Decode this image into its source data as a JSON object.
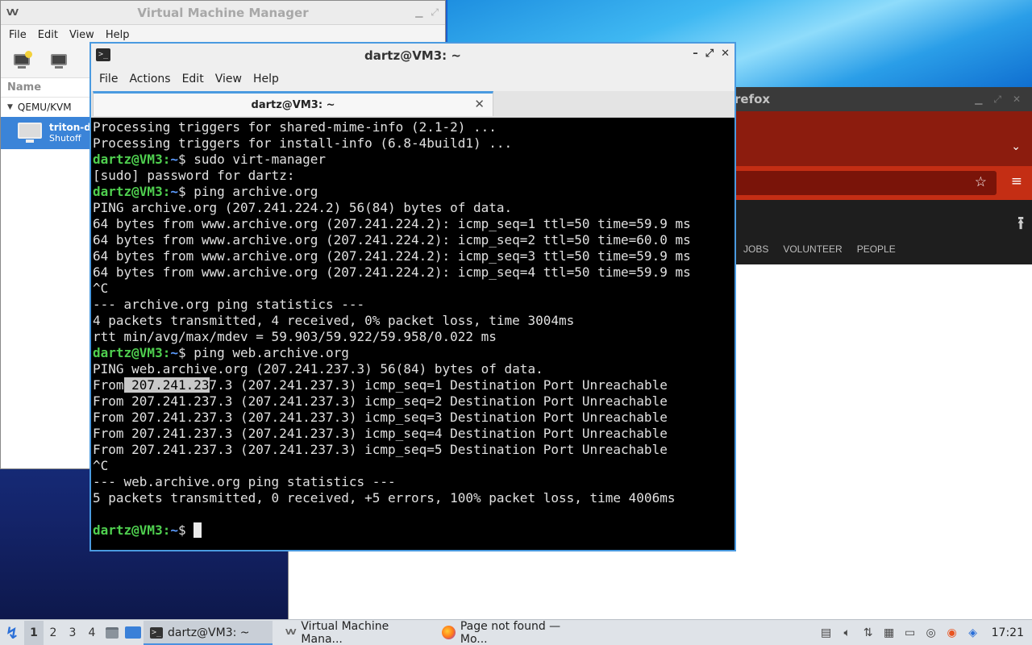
{
  "vmm": {
    "title": "Virtual Machine Manager",
    "menu": [
      "File",
      "Edit",
      "View",
      "Help"
    ],
    "column_header": "Name",
    "group": "QEMU/KVM",
    "vm": {
      "name": "triton-d",
      "status": "Shutoff"
    }
  },
  "firefox": {
    "title_fragment": "refox",
    "nav_links": [
      "JOBS",
      "VOLUNTEER",
      "PEOPLE"
    ]
  },
  "terminal": {
    "title": "dartz@VM3: ~",
    "menu": [
      "File",
      "Actions",
      "Edit",
      "View",
      "Help"
    ],
    "tab_label": "dartz@VM3: ~",
    "prompt_user": "dartz@VM3",
    "prompt_path": "~",
    "lines": [
      {
        "type": "out",
        "text": "Processing triggers for shared-mime-info (2.1-2) ..."
      },
      {
        "type": "out",
        "text": "Processing triggers for install-info (6.8-4build1) ..."
      },
      {
        "type": "cmd",
        "text": "sudo virt-manager"
      },
      {
        "type": "out",
        "text": "[sudo] password for dartz:"
      },
      {
        "type": "cmd",
        "text": "ping archive.org"
      },
      {
        "type": "out",
        "text": "PING archive.org (207.241.224.2) 56(84) bytes of data."
      },
      {
        "type": "out",
        "text": "64 bytes from www.archive.org (207.241.224.2): icmp_seq=1 ttl=50 time=59.9 ms"
      },
      {
        "type": "out",
        "text": "64 bytes from www.archive.org (207.241.224.2): icmp_seq=2 ttl=50 time=60.0 ms"
      },
      {
        "type": "out",
        "text": "64 bytes from www.archive.org (207.241.224.2): icmp_seq=3 ttl=50 time=59.9 ms"
      },
      {
        "type": "out",
        "text": "64 bytes from www.archive.org (207.241.224.2): icmp_seq=4 ttl=50 time=59.9 ms"
      },
      {
        "type": "out",
        "text": "^C"
      },
      {
        "type": "out",
        "text": "--- archive.org ping statistics ---"
      },
      {
        "type": "out",
        "text": "4 packets transmitted, 4 received, 0% packet loss, time 3004ms"
      },
      {
        "type": "out",
        "text": "rtt min/avg/max/mdev = 59.903/59.922/59.958/0.022 ms"
      },
      {
        "type": "cmd",
        "text": "ping web.archive.org"
      },
      {
        "type": "out",
        "text": "PING web.archive.org (207.241.237.3) 56(84) bytes of data."
      },
      {
        "type": "sel",
        "pre": "From",
        "sel": " 207.241.23",
        "post": "7.3 (207.241.237.3) icmp_seq=1 Destination Port Unreachable"
      },
      {
        "type": "out",
        "text": "From 207.241.237.3 (207.241.237.3) icmp_seq=2 Destination Port Unreachable"
      },
      {
        "type": "out",
        "text": "From 207.241.237.3 (207.241.237.3) icmp_seq=3 Destination Port Unreachable"
      },
      {
        "type": "out",
        "text": "From 207.241.237.3 (207.241.237.3) icmp_seq=4 Destination Port Unreachable"
      },
      {
        "type": "out",
        "text": "From 207.241.237.3 (207.241.237.3) icmp_seq=5 Destination Port Unreachable"
      },
      {
        "type": "out",
        "text": "^C"
      },
      {
        "type": "out",
        "text": "--- web.archive.org ping statistics ---"
      },
      {
        "type": "out",
        "text": "5 packets transmitted, 0 received, +5 errors, 100% packet loss, time 4006ms"
      },
      {
        "type": "out",
        "text": ""
      },
      {
        "type": "cursor",
        "text": ""
      }
    ]
  },
  "taskbar": {
    "workspaces": [
      "1",
      "2",
      "3",
      "4"
    ],
    "tasks": [
      {
        "label": "dartz@VM3: ~",
        "icon": "terminal-icon",
        "active": true
      },
      {
        "label": "Virtual Machine Mana...",
        "icon": "virt-manager-icon",
        "active": false
      },
      {
        "label": "Page not found — Mo...",
        "icon": "firefox-icon",
        "active": false
      }
    ],
    "clock": "17:21"
  }
}
